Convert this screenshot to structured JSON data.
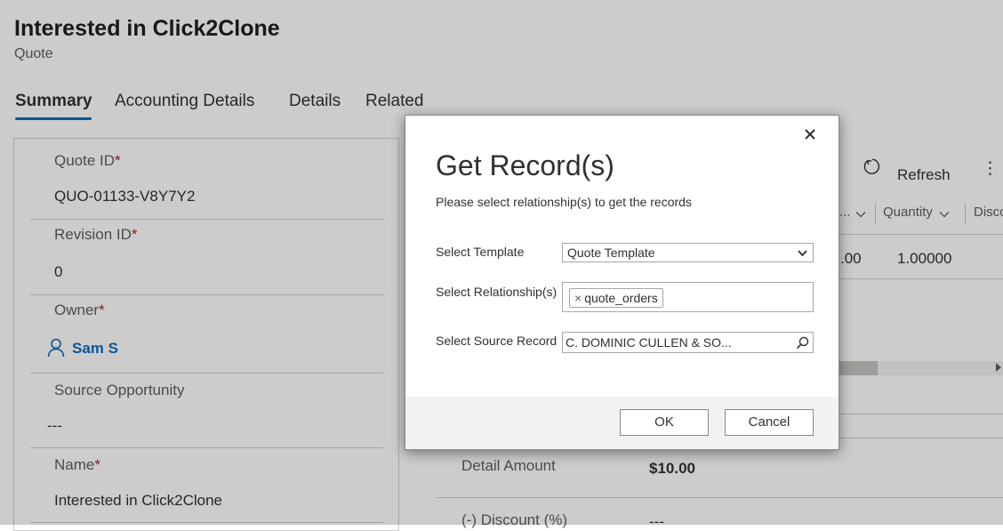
{
  "record": {
    "title": "Interested in Click2Clone",
    "entity": "Quote"
  },
  "tabs": [
    {
      "label": "Summary"
    },
    {
      "label": "Accounting Details"
    },
    {
      "label": "Details"
    },
    {
      "label": "Related"
    }
  ],
  "fields": {
    "quote_id": {
      "label": "Quote ID",
      "required_mark": "*",
      "value": "QUO-01133-V8Y7Y2"
    },
    "revision_id": {
      "label": "Revision ID",
      "required_mark": "*",
      "value": "0"
    },
    "owner": {
      "label": "Owner",
      "required_mark": "*",
      "value": "Sam S"
    },
    "source_opportunity": {
      "label": "Source Opportunity",
      "value": "---"
    },
    "name": {
      "label": "Name",
      "required_mark": "*",
      "value": "Interested in Click2Clone"
    }
  },
  "commands": {
    "refresh": "Refresh",
    "more": "⋮"
  },
  "grid": {
    "columns": [
      {
        "label": "..."
      },
      {
        "label": "Quantity"
      },
      {
        "label": "Disco"
      }
    ],
    "row": {
      "partial_value": ".00",
      "quantity": "1.00000"
    }
  },
  "summary": {
    "detail_amount": {
      "label": "Detail Amount",
      "value": "$10.00"
    },
    "discount": {
      "label": "(-) Discount (%)",
      "value": "---"
    }
  },
  "dialog": {
    "title": "Get Record(s)",
    "subtitle": "Please select relationship(s) to get the records",
    "template_label": "Select Template",
    "template_value": "Quote Template",
    "relationship_label": "Select Relationship(s)",
    "relationship_tag": "quote_orders",
    "tag_remove": "×",
    "source_label": "Select Source Record",
    "source_value": "C. DOMINIC CULLEN & SO...",
    "ok": "OK",
    "cancel": "Cancel",
    "close": "×"
  },
  "colors": {
    "accent": "#0f6cbd",
    "required": "#a4262c",
    "overlay": "rgba(0,0,0,0.2)"
  }
}
